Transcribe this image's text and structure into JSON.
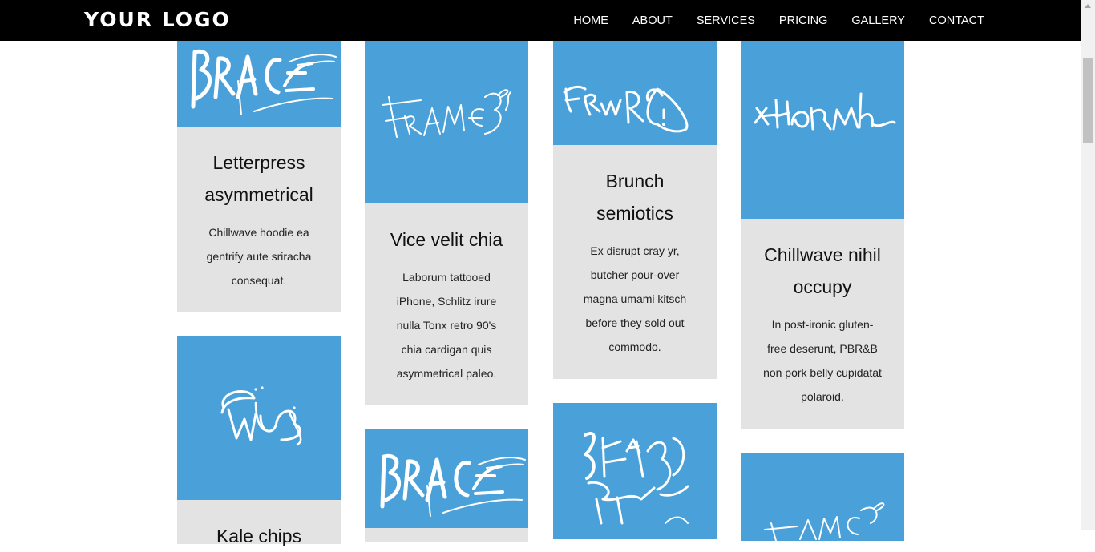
{
  "header": {
    "logo": "YOUR LOGO",
    "nav": [
      "HOME",
      "ABOUT",
      "SERVICES",
      "PRICING",
      "GALLERY",
      "CONTACT"
    ]
  },
  "colors": {
    "accent": "#4aa0d8",
    "card_bg": "#e3e3e3",
    "nav_bg": "#000000"
  },
  "cards": [
    {
      "title_line1": "Letterpress",
      "title_line2": "asymmetrical",
      "text": [
        "Chillwave hoodie ea",
        "gentrify aute sriracha",
        "consequat."
      ],
      "image_icon": "brace-tag-image"
    },
    {
      "title_line1": "Vice velit chia",
      "text": [
        "Laborum tattooed",
        "iPhone, Schlitz irure",
        "nulla Tonx retro 90's",
        "chia cardigan quis",
        "asymmetrical paleo."
      ],
      "image_icon": "frames-tag-image"
    },
    {
      "title_line1": "Brunch",
      "title_line2": "semiotics",
      "text": [
        "Ex disrupt cray yr,",
        "butcher pour-over",
        "magna umami kitsch",
        "before they sold out",
        "commodo."
      ],
      "image_icon": "fenwo-tag-image"
    },
    {
      "title_line1": "Chillwave nihil",
      "title_line2": "occupy",
      "text": [
        "In post-ironic gluten-",
        "free deserunt, PBR&B",
        "non pork belly cupidatat",
        "polaroid."
      ],
      "image_icon": "cursive-tag-image"
    },
    {
      "title_line1": "Kale chips",
      "image_icon": "circle-tag-image"
    },
    {
      "image_icon": "brace-tag-image"
    },
    {
      "image_icon": "scribble-tag-image"
    },
    {
      "image_icon": "frames-tag-image"
    }
  ]
}
